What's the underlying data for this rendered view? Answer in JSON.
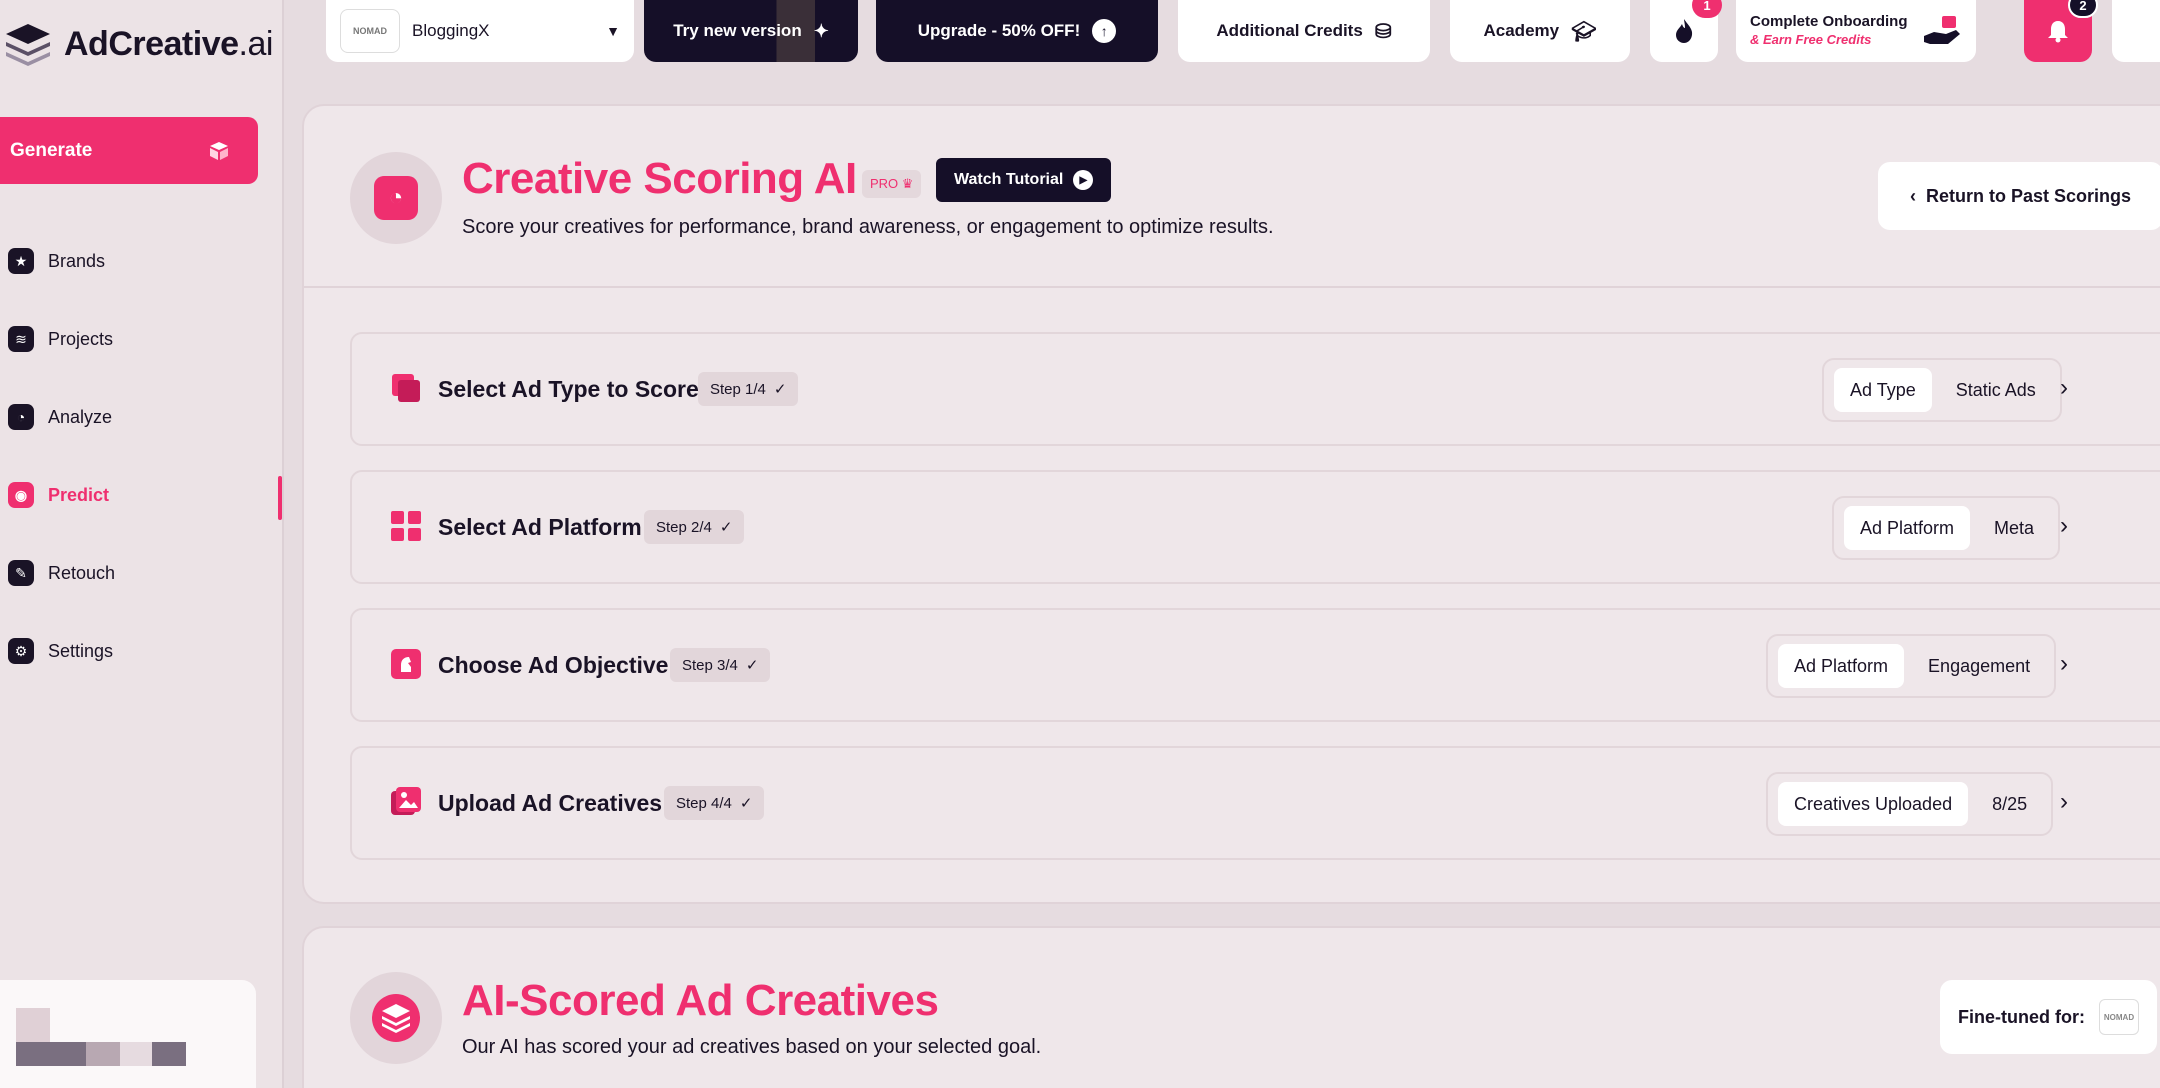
{
  "sidebar": {
    "logo": {
      "main": "AdCreative",
      "suffix": ".ai"
    },
    "generate_label": "Generate",
    "items": [
      {
        "label": "Brands",
        "icon": "star-icon"
      },
      {
        "label": "Projects",
        "icon": "layers-icon"
      },
      {
        "label": "Analyze",
        "icon": "gauge-icon"
      },
      {
        "label": "Predict",
        "icon": "predict-icon",
        "active": true
      },
      {
        "label": "Retouch",
        "icon": "wand-icon"
      },
      {
        "label": "Settings",
        "icon": "gear-icon"
      }
    ]
  },
  "topbar": {
    "brand_name": "BloggingX",
    "brand_thumb_text": "NOMAD",
    "try_new_version": "Try new version",
    "upgrade": "Upgrade - 50% OFF!",
    "additional_credits": "Additional Credits",
    "academy": "Academy",
    "streak_badge": "1",
    "onboarding_title": "Complete Onboarding",
    "onboarding_sub": "& Earn Free Credits",
    "notifications_badge": "2"
  },
  "scoring": {
    "title": "Creative Scoring AI",
    "pro_label": "PRO",
    "tutorial_label": "Watch Tutorial",
    "subtitle": "Score your creatives for performance, brand awareness, or engagement to optimize results.",
    "return_label": "Return to Past Scorings",
    "steps": [
      {
        "title": "Select Ad Type to Score",
        "step": "Step 1/4",
        "key": "Ad Type",
        "value": "Static Ads"
      },
      {
        "title": "Select Ad Platform",
        "step": "Step 2/4",
        "key": "Ad Platform",
        "value": "Meta"
      },
      {
        "title": "Choose Ad Objective",
        "step": "Step 3/4",
        "key": "Ad Platform",
        "value": "Engagement"
      },
      {
        "title": "Upload Ad Creatives",
        "step": "Step 4/4",
        "key": "Creatives Uploaded",
        "value": "8/25"
      }
    ]
  },
  "scored": {
    "title": "AI-Scored Ad Creatives",
    "subtitle": "Our AI has scored your ad creatives based on your selected goal.",
    "fine_tuned_label": "Fine-tuned for:",
    "fine_tuned_thumb_text": "NOMAD"
  },
  "colors": {
    "accent": "#ef2f6f",
    "dark": "#150f28",
    "background": "#e6dce0"
  }
}
